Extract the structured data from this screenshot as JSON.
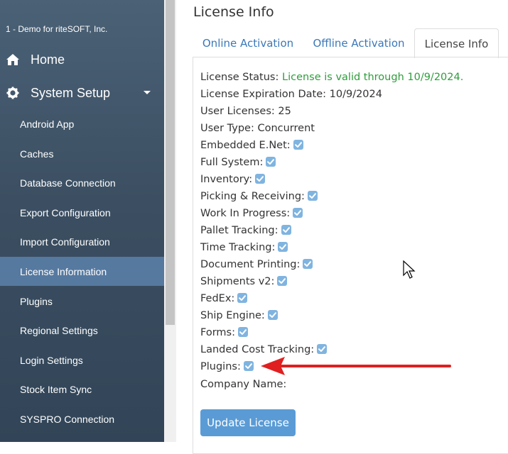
{
  "sidebar": {
    "company": "1 - Demo for riteSOFT, Inc.",
    "home": {
      "label": "Home",
      "icon": "home-icon"
    },
    "system_setup": {
      "label": "System Setup",
      "icon": "gear-icon"
    },
    "items": [
      {
        "label": "Android App"
      },
      {
        "label": "Caches"
      },
      {
        "label": "Database Connection"
      },
      {
        "label": "Export Configuration"
      },
      {
        "label": "Import Configuration"
      },
      {
        "label": "License Information",
        "active": true
      },
      {
        "label": "Plugins"
      },
      {
        "label": "Regional Settings"
      },
      {
        "label": "Login Settings"
      },
      {
        "label": "Stock Item Sync"
      },
      {
        "label": "SYSPRO Connection"
      }
    ]
  },
  "page": {
    "title": "License Info",
    "tabs": [
      {
        "label": "Online Activation"
      },
      {
        "label": "Offline Activation"
      },
      {
        "label": "License Info",
        "active": true
      }
    ]
  },
  "license": {
    "status_label": "License Status:",
    "status_value": "License is valid through 10/9/2024.",
    "expiration": "License Expiration Date: 10/9/2024",
    "user_licenses": "User Licenses: 25",
    "user_type": "User Type: Concurrent",
    "features": [
      {
        "label": "Embedded E.Net:",
        "checked": true
      },
      {
        "label": "Full System:",
        "checked": true
      },
      {
        "label": "Inventory:",
        "checked": true
      },
      {
        "label": "Picking & Receiving:",
        "checked": true
      },
      {
        "label": "Work In Progress:",
        "checked": true
      },
      {
        "label": "Pallet Tracking:",
        "checked": true
      },
      {
        "label": "Time Tracking:",
        "checked": true
      },
      {
        "label": "Document Printing:",
        "checked": true
      },
      {
        "label": "Shipments v2:",
        "checked": true
      },
      {
        "label": "FedEx:",
        "checked": true
      },
      {
        "label": "Ship Engine:",
        "checked": true
      },
      {
        "label": "Forms:",
        "checked": true
      },
      {
        "label": "Landed Cost Tracking:",
        "checked": true
      },
      {
        "label": "Plugins:",
        "checked": true
      }
    ],
    "company_name": "Company Name:",
    "update_button": "Update License"
  },
  "colors": {
    "sidebar_bg": "#3f5366",
    "active_item": "#5679a0",
    "tab_link": "#3a78b8",
    "valid_green": "#2e9d3b",
    "checkbox": "#80b4e0",
    "button": "#5a9bd5",
    "annotation_arrow": "#e02020"
  }
}
